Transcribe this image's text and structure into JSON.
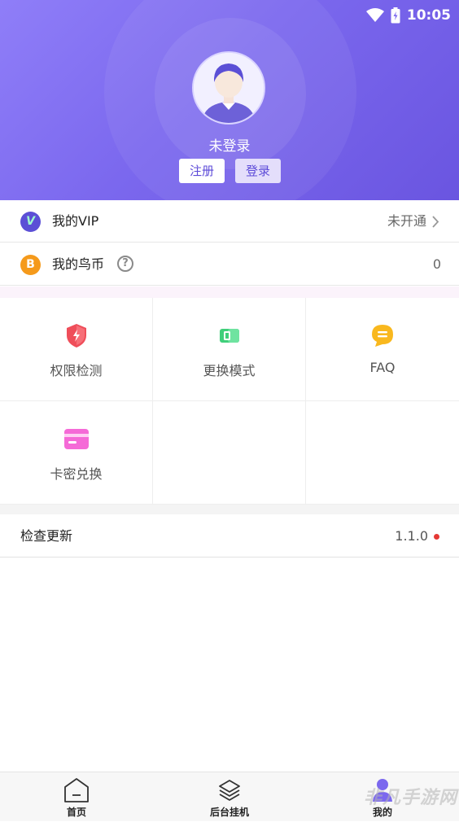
{
  "status_bar": {
    "time": "10:05",
    "wifi_icon": "wifi-icon",
    "battery_icon": "battery-icon"
  },
  "header": {
    "login_status": "未登录",
    "register_label": "注册",
    "login_label": "登录",
    "avatar_icon": "default-avatar-icon"
  },
  "account": {
    "vip": {
      "icon_letter": "V",
      "label": "我的VIP",
      "value": "未开通",
      "icon_color": "#5b4fd6"
    },
    "coins": {
      "icon_letter": "B",
      "label": "我的鸟币",
      "value": "0",
      "icon_color": "#f59a1b"
    }
  },
  "features": [
    {
      "label": "权限检测",
      "icon": "shield-icon"
    },
    {
      "label": "更换模式",
      "icon": "switch-mode-icon"
    },
    {
      "label": "FAQ",
      "icon": "chat-bubble-icon"
    },
    {
      "label": "卡密兑换",
      "icon": "card-icon"
    }
  ],
  "update": {
    "label": "检查更新",
    "version": "1.1.0"
  },
  "bottom_nav": [
    {
      "label": "首页",
      "icon": "home-icon",
      "active": false
    },
    {
      "label": "后台挂机",
      "icon": "layers-icon",
      "active": false
    },
    {
      "label": "我的",
      "icon": "profile-icon",
      "active": true
    }
  ],
  "watermark": "非凡手游网",
  "colors": {
    "accent": "#7b68ee",
    "header_start": "#8f7ef8",
    "header_end": "#6a55e0",
    "update_dot": "#e53935"
  }
}
